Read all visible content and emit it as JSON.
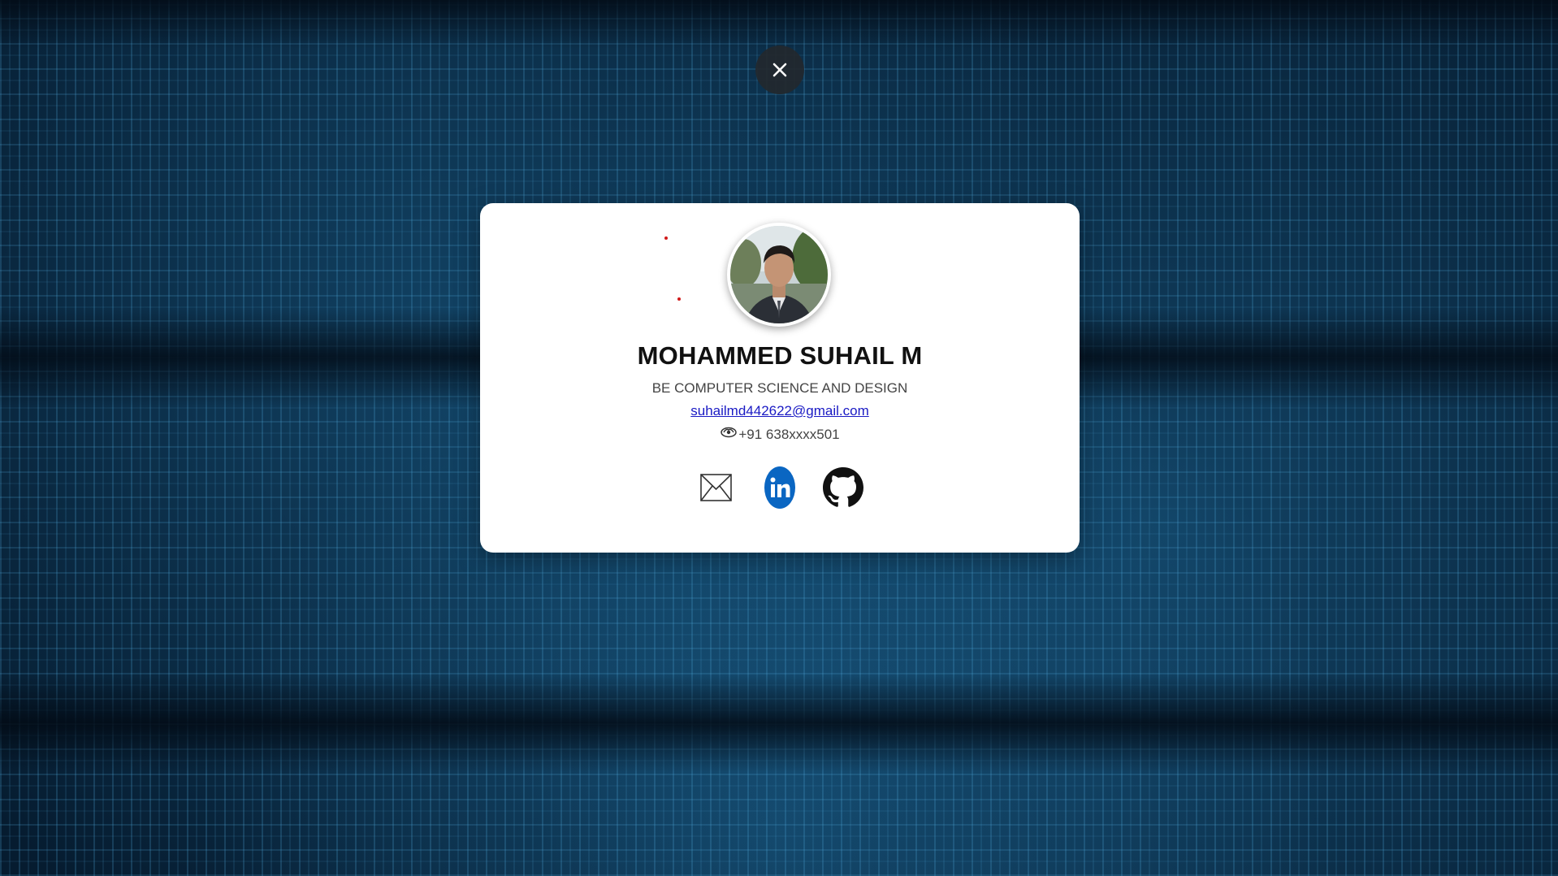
{
  "close": {
    "icon": "close-icon"
  },
  "profile": {
    "name": "MOHAMMED SUHAIL M",
    "degree": "BE COMPUTER SCIENCE AND DESIGN",
    "email": "suhailmd442622@gmail.com",
    "phone": "+91 638xxxx501"
  },
  "socials": [
    {
      "name": "email-icon"
    },
    {
      "name": "linkedin-icon"
    },
    {
      "name": "github-icon"
    }
  ],
  "colors": {
    "card_bg": "#ffffff",
    "link": "#1a1ac4",
    "linkedin": "#0a66c2",
    "background": "#061c30"
  }
}
